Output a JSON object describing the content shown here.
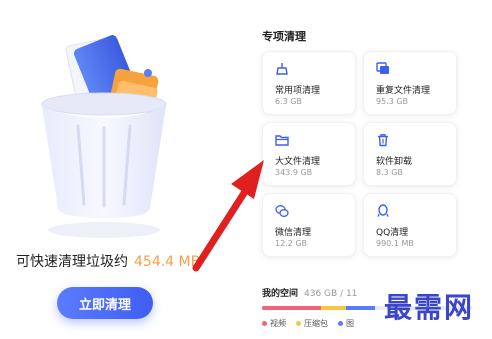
{
  "summary": {
    "text": "可快速清理垃圾约",
    "size": "454.4 MB"
  },
  "clean_button": {
    "label": "立即清理"
  },
  "special": {
    "title": "专项清理",
    "cards": [
      {
        "name": "常用项清理",
        "value": "6.3 GB",
        "icon": "broom-icon"
      },
      {
        "name": "重复文件清理",
        "value": "95.3 GB",
        "icon": "duplicate-files-icon"
      },
      {
        "name": "大文件清理",
        "value": "343.9 GB",
        "icon": "folder-icon"
      },
      {
        "name": "软件卸载",
        "value": "8.3 GB",
        "icon": "trash-icon"
      },
      {
        "name": "微信清理",
        "value": "12.2 GB",
        "icon": "wechat-icon"
      },
      {
        "name": "QQ清理",
        "value": "990.1 MB",
        "icon": "qq-icon"
      }
    ]
  },
  "space": {
    "title": "我的空间",
    "capacity": "436 GB / 11",
    "legend": [
      {
        "label": "视频",
        "color": "#f2637b"
      },
      {
        "label": "压缩包",
        "color": "#f7c744"
      },
      {
        "label": "图",
        "color": "#5b7bff"
      }
    ]
  },
  "watermark": "最需网",
  "colors": {
    "accent": "#4a66f5",
    "highlight": "#f6a14a",
    "arrow": "#e02020"
  }
}
